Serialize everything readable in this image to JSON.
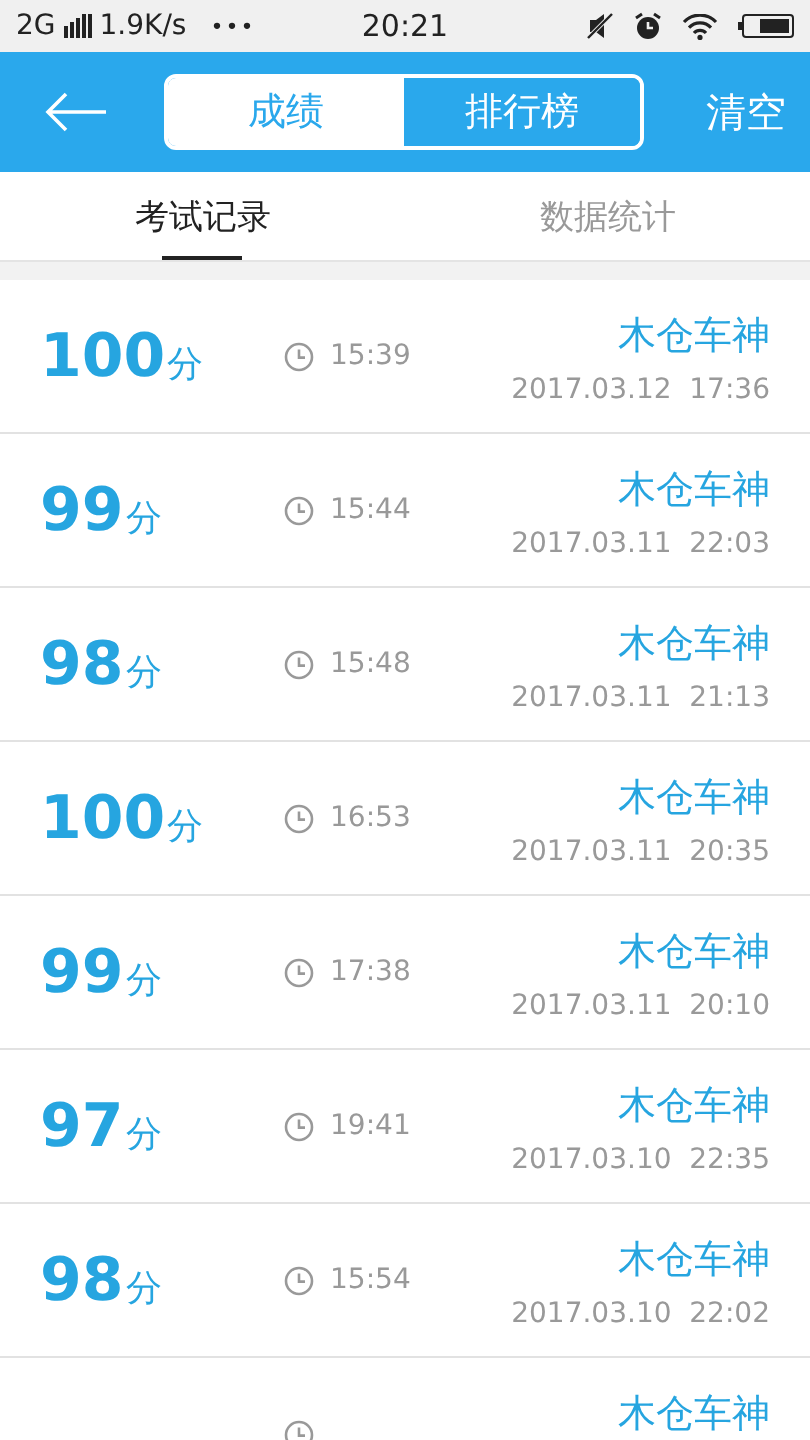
{
  "status_bar": {
    "network": "2G",
    "speed": "1.9K/s",
    "more": "•••",
    "time": "20:21"
  },
  "header": {
    "segments": [
      {
        "label": "成绩",
        "selected": true
      },
      {
        "label": "排行榜",
        "selected": false
      }
    ],
    "action": "清空"
  },
  "tabs": [
    {
      "label": "考试记录",
      "selected": true
    },
    {
      "label": "数据统计",
      "selected": false
    }
  ],
  "records": [
    {
      "score": "100",
      "unit": "分",
      "duration": "15:39",
      "user": "木仓车神",
      "date": "2017.03.12  17:36"
    },
    {
      "score": "99",
      "unit": "分",
      "duration": "15:44",
      "user": "木仓车神",
      "date": "2017.03.11  22:03"
    },
    {
      "score": "98",
      "unit": "分",
      "duration": "15:48",
      "user": "木仓车神",
      "date": "2017.03.11  21:13"
    },
    {
      "score": "100",
      "unit": "分",
      "duration": "16:53",
      "user": "木仓车神",
      "date": "2017.03.11  20:35"
    },
    {
      "score": "99",
      "unit": "分",
      "duration": "17:38",
      "user": "木仓车神",
      "date": "2017.03.11  20:10"
    },
    {
      "score": "97",
      "unit": "分",
      "duration": "19:41",
      "user": "木仓车神",
      "date": "2017.03.10  22:35"
    },
    {
      "score": "98",
      "unit": "分",
      "duration": "15:54",
      "user": "木仓车神",
      "date": "2017.03.10  22:02"
    },
    {
      "user": "木仓车神"
    }
  ]
}
